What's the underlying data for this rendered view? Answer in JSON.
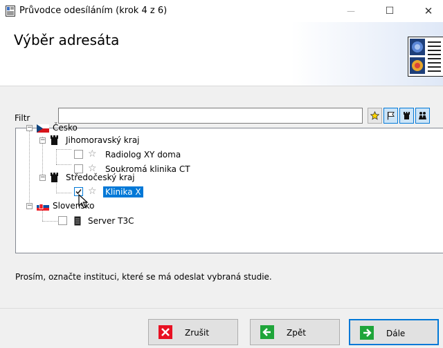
{
  "window": {
    "title": "Průvodce odesíláním (krok 4 z 6)",
    "min_glyph": "—",
    "max_glyph": "☐",
    "close_glyph": "✕"
  },
  "header": {
    "title": "Výběr adresáta"
  },
  "filter": {
    "label": "Filtr",
    "value": "",
    "placeholder": ""
  },
  "filter_buttons": [
    {
      "name": "star-filter",
      "icon": "star-icon",
      "active": false
    },
    {
      "name": "flag-filter",
      "icon": "flag-icon",
      "active": true
    },
    {
      "name": "tower-filter",
      "icon": "tower-icon",
      "active": true
    },
    {
      "name": "group-filter",
      "icon": "group-icon",
      "active": true
    }
  ],
  "tree": {
    "country_cz": "Česko",
    "region_jm": "Jihomoravský kraj",
    "item_radiolog": "Radiolog XY doma",
    "item_klinika_ct": "Soukromá klinika CT",
    "region_sc": "Středočeský kraj",
    "item_klinika_x": "Klinika X",
    "country_sk": "Slovensko",
    "item_server": "Server T3C"
  },
  "hint": "Prosím, označte instituci, které se má odeslat vybraná studie.",
  "buttons": {
    "cancel": "Zrušit",
    "back": "Zpět",
    "next": "Dále"
  },
  "colors": {
    "selection": "#0078d7",
    "cancel_icon": "#e81123",
    "nav_icon": "#1fa53a"
  }
}
